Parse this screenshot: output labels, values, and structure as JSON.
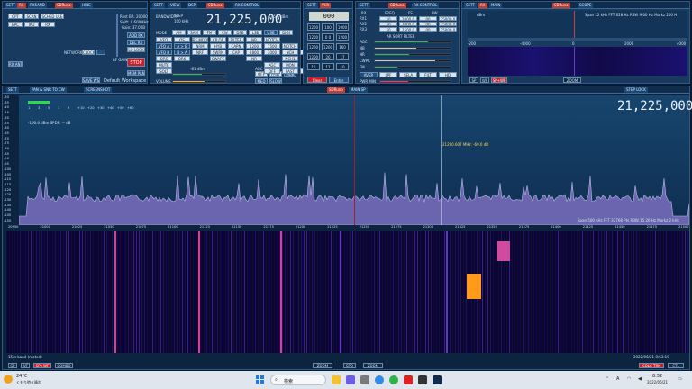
{
  "vfo_panel": {
    "title_items": [
      "SETT",
      "RX",
      "RX5AND",
      "SDRuno",
      "HIDE"
    ],
    "row1": [
      "OPT",
      "SCAN",
      "SCHED ULE"
    ],
    "row2": [
      "EPC",
      "IPO",
      "RX"
    ],
    "rf_gain": "RF GAIN",
    "info": [
      "Rest BR: 20000",
      "Shift: 0.600MHz (LIF)",
      "Gain: 37.00B"
    ],
    "buttons": [
      "ADD RX",
      "DEL RX",
      "LO LOCK",
      "STOP",
      "MEM PAN"
    ],
    "network": "NETWORK",
    "clock": "CLOCK",
    "rx_ant": "RX ANT",
    "workspace_save": "SAVE WS",
    "workspace_name": "Default Workspace"
  },
  "rx_control": {
    "title_items": [
      "SETT",
      "VIEW",
      "DSP",
      "SDRuno",
      "RX CONTROL"
    ],
    "bandwidth_label": "BANDWIDTH",
    "step_label": "STEP",
    "step_value": "100 kHz",
    "frequency": "21,225,000",
    "level": "-105.6 dBm",
    "mode_label": "MODE",
    "modes": [
      "AM",
      "SAM",
      "FM",
      "CW",
      "DSB",
      "LSB",
      "USB",
      "DIGI"
    ],
    "rows": [
      [
        "VFO",
        "QS",
        "RF MODE",
        "CP OF",
        "FILTER",
        "NB",
        "NOTCH"
      ],
      [
        "VFO A",
        "A > B",
        "NRM",
        "HYB",
        "CAPN",
        "1200",
        "1500",
        "NOTCH"
      ],
      [
        "VFO B",
        "B > A",
        "NRF",
        "SWRN",
        "CAP",
        "2800",
        "3000",
        "NCH",
        "MEM"
      ],
      [
        "QRS",
        "QRK",
        "",
        "CWAFC",
        "",
        "NR",
        "",
        "NCH1"
      ],
      [
        "MUTE",
        "",
        "",
        "",
        "",
        "",
        "AGC",
        "MON"
      ],
      [
        "SQLT",
        "",
        "",
        "",
        "",
        "",
        "OFF",
        "FAST",
        "MDB"
      ]
    ],
    "volume": "VOLUME",
    "meter_level": "-81 dBm",
    "agc": "AGC",
    "agc_opts": [
      "OFF",
      "FAST",
      "MDB"
    ],
    "med": "MED",
    "slow": "SLOW"
  },
  "main_bar": {
    "items": [
      "SETT",
      "VCR",
      "MUTE",
      "TCW"
    ]
  },
  "keypad": {
    "display": "000",
    "keys": [
      "7",
      "8",
      "9",
      "4",
      "5",
      "6",
      "1",
      "2",
      "3",
      "0",
      "Enter",
      "Clear"
    ],
    "band_keys": [
      "1200",
      "100",
      "1000",
      "1200",
      "0 0",
      "1200",
      "1200",
      "1200",
      "160",
      "1200",
      "20",
      "17",
      "15",
      "12",
      "10",
      "6"
    ],
    "bottom": [
      "Clear",
      "Enter"
    ]
  },
  "rx_ctrl2": {
    "title_items": [
      "SETT",
      "SDRuno",
      "RX CONTROL"
    ],
    "cols": [
      "RX",
      "FREQ",
      "FS",
      "BW"
    ],
    "rows": [
      [
        "RX1",
        "50",
        "1000.0",
        "00",
        "25000.0"
      ],
      [
        "RX2",
        "50",
        "1000.0",
        "00",
        "25000.0"
      ],
      [
        "RX3",
        "50",
        "1500.0",
        "00",
        "25000.0"
      ]
    ],
    "sub_label": "AR SORT FILTER",
    "side_labels": [
      "AGC",
      "NB",
      "NR",
      "CWPK",
      "FM"
    ],
    "btns": [
      "AVER",
      "LPF",
      "SELA",
      "FILT",
      "HD"
    ],
    "pwr": "PWR MIN"
  },
  "spectrum_small": {
    "title_items": [
      "SETT",
      "RX",
      "MAIN",
      "SDRuno",
      "SCOPE"
    ],
    "db_label": "dBm",
    "span": "Span 12 kHz  FFT 628 Hz  RBW 9.60 Hz  Markz 200 H",
    "ticks": [
      "-200",
      "-4000",
      "0",
      "2000",
      "4000"
    ],
    "bottom": [
      "SP",
      "WF",
      "SP+WF",
      "ZOOM"
    ]
  },
  "main_spectrum": {
    "title_items": [
      "SETT",
      "PAN & SNR TO CW",
      "SCREENSHOT",
      "SDRuno",
      "MAIN SP"
    ],
    "step_lock": "STEP LOCK",
    "frequency": "21,225,000",
    "info": "-106.6 dBm  SPDR: -- dB",
    "db_ticks": [
      "-30",
      "-35",
      "-40",
      "-45",
      "-50",
      "-55",
      "-60",
      "-65",
      "-70",
      "-75",
      "-80",
      "-85",
      "-90",
      "-95",
      "-100",
      "-105",
      "-110",
      "-115",
      "-120",
      "-125",
      "-130",
      "-135",
      "-140",
      "-145",
      "-150"
    ],
    "scale_marks": [
      "1",
      "3",
      "5",
      "7",
      "9",
      "+10",
      "+20",
      "+30",
      "+40",
      "+50",
      "+60"
    ],
    "marker_text": "21290.607 MHz: -69.0 dB",
    "freq_ticks": [
      "20950",
      "21000",
      "21025",
      "21050",
      "21075",
      "21100",
      "21125",
      "21150",
      "21175",
      "21200",
      "21225",
      "21250",
      "21275",
      "21300",
      "21325",
      "21350",
      "21375",
      "21400",
      "21425",
      "21450",
      "21475",
      "21500"
    ],
    "span_info": "Span 500 kHz  FFT 32768 Pts  RBW 15.26 Hz  Markz 2 kHz",
    "band_label": "15m band (rooted)",
    "timestamp": "2022/06/21 8:53:19",
    "bottom_left": [
      "SP",
      "WF",
      "SP+WF",
      "COMBO"
    ],
    "bottom_mid": [
      "ZOOM",
      "SPD",
      "ZOOM"
    ],
    "bottom_right": [
      "SQLC TRK",
      "CTL"
    ]
  },
  "taskbar": {
    "weather_temp": "24°C",
    "weather_desc": "くもり時々晴れ",
    "search": "検索",
    "time": "8:52",
    "date": "2022/06/21",
    "ime": "A"
  },
  "colors": {
    "spectrum_fill": "#7b6fc0",
    "waterfall_bg": "#0a0630",
    "accent_red": "#c8202a",
    "vfo_blue": "#1f4e82"
  }
}
